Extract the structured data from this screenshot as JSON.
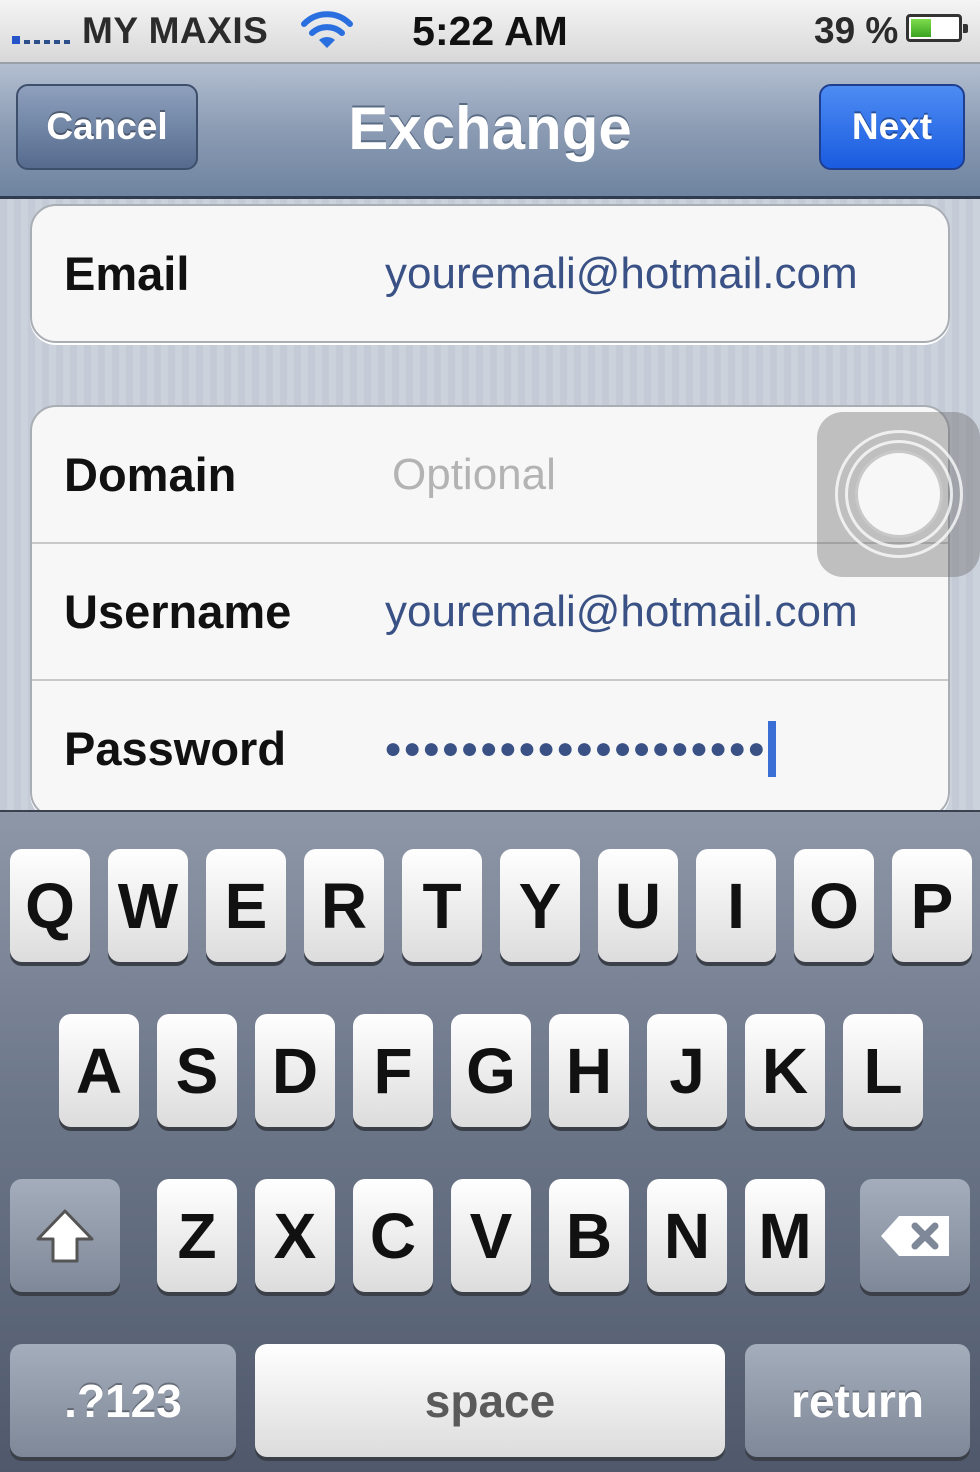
{
  "status_bar": {
    "carrier": "MY MAXIS",
    "time": "5:22 AM",
    "battery_percent": "39 %",
    "battery_level": 0.39,
    "icons": [
      "signal-icon",
      "wifi-icon",
      "battery-icon"
    ]
  },
  "nav": {
    "title": "Exchange",
    "cancel_label": "Cancel",
    "next_label": "Next"
  },
  "form": {
    "email": {
      "label": "Email",
      "value": "youremali@hotmail.com"
    },
    "domain": {
      "label": "Domain",
      "placeholder": "Optional"
    },
    "username": {
      "label": "Username",
      "value": "youremali@hotmail.com"
    },
    "password": {
      "label": "Password",
      "masked": "●●●●●●●●●●●●●●●●●●●●"
    }
  },
  "keyboard": {
    "row1": [
      "Q",
      "W",
      "E",
      "R",
      "T",
      "Y",
      "U",
      "I",
      "O",
      "P"
    ],
    "row2": [
      "A",
      "S",
      "D",
      "F",
      "G",
      "H",
      "J",
      "K",
      "L"
    ],
    "row3": [
      "Z",
      "X",
      "C",
      "V",
      "B",
      "N",
      "M"
    ],
    "numbers_label": ".?123",
    "space_label": "space",
    "return_label": "return"
  },
  "colors": {
    "accent_blue": "#1a5be0",
    "field_value": "#3a5185",
    "nav_bar": "#8b9bb3"
  }
}
